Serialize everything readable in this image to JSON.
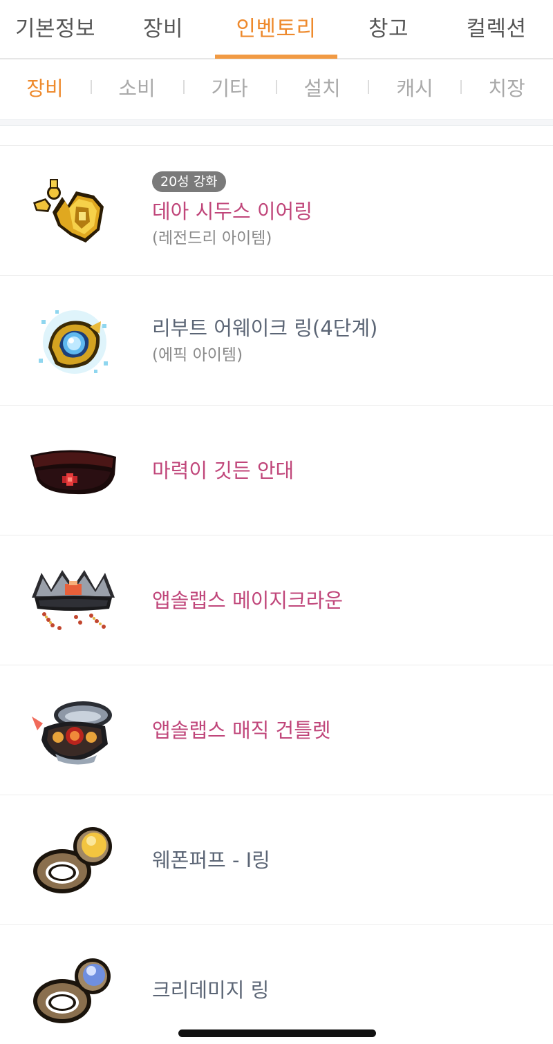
{
  "main_tabs": [
    {
      "label": "기본정보",
      "active": false
    },
    {
      "label": "장비",
      "active": false
    },
    {
      "label": "인벤토리",
      "active": true
    },
    {
      "label": "창고",
      "active": false
    },
    {
      "label": "컬렉션",
      "active": false
    }
  ],
  "sub_tabs": [
    {
      "label": "장비",
      "active": true
    },
    {
      "label": "소비",
      "active": false
    },
    {
      "label": "기타",
      "active": false
    },
    {
      "label": "설치",
      "active": false
    },
    {
      "label": "캐시",
      "active": false
    },
    {
      "label": "치장",
      "active": false
    }
  ],
  "items": [
    {
      "badge": "20성 강화",
      "name": "데아 시두스 이어링",
      "grade": "(레전드리 아이템)",
      "icon": "golden-shield-earring-icon",
      "name_color": "#c0467a"
    },
    {
      "badge": "",
      "name": "리부트 어웨이크 링(4단계)",
      "grade": "(에픽 아이템)",
      "icon": "awake-ring-icon",
      "name_color": "#5b6575"
    },
    {
      "badge": "",
      "name": "마력이 깃든 안대",
      "grade": "",
      "icon": "eyepatch-icon",
      "name_color": "#c0467a"
    },
    {
      "badge": "",
      "name": "앱솔랩스 메이지크라운",
      "grade": "",
      "icon": "crown-icon",
      "name_color": "#c0467a"
    },
    {
      "badge": "",
      "name": "앱솔랩스 매직 건틀렛",
      "grade": "",
      "icon": "gauntlet-icon",
      "name_color": "#c0467a"
    },
    {
      "badge": "",
      "name": "웨폰퍼프 - I링",
      "grade": "",
      "icon": "gold-gem-ring-icon",
      "name_color": "#5b6575"
    },
    {
      "badge": "",
      "name": "크리데미지 링",
      "grade": "",
      "icon": "blue-gem-ring-icon",
      "name_color": "#5b6575"
    }
  ],
  "colors": {
    "accent": "#ee8a2d",
    "item_name_pink": "#c0467a",
    "item_name_default": "#5b6575",
    "badge_bg": "#7a7a7a"
  }
}
